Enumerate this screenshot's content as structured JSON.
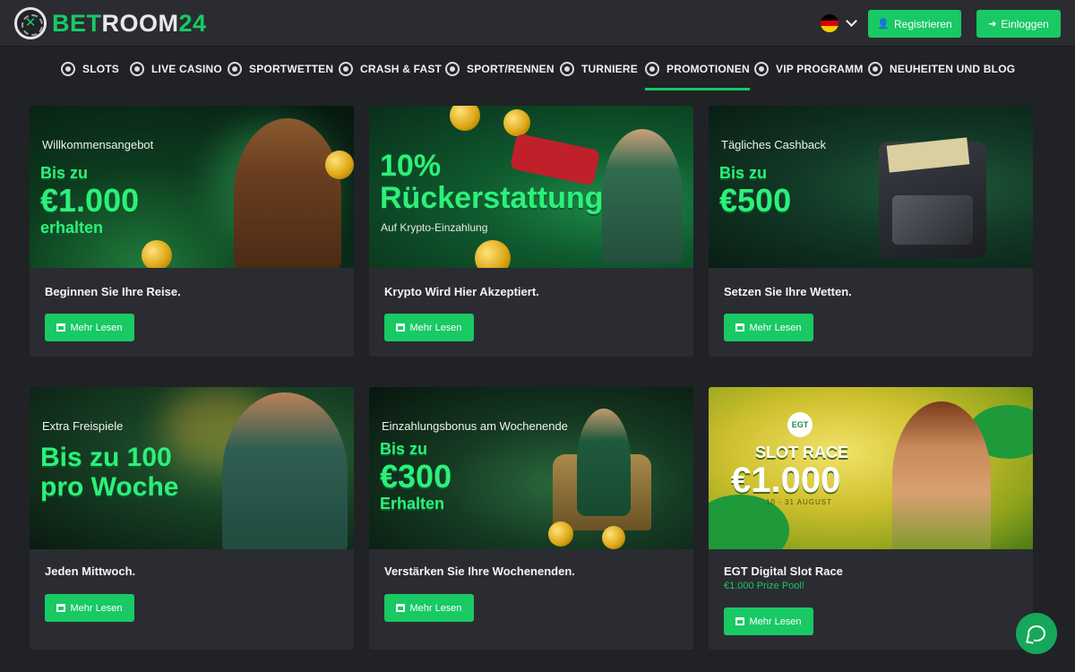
{
  "header": {
    "logo_bet": "BET",
    "logo_room": "ROOM",
    "logo_num": "24",
    "language_flag": "germany-flag",
    "register_label": "Registrieren",
    "login_label": "Einloggen"
  },
  "nav": {
    "items": [
      {
        "label": "SLOTS",
        "icon": "slots-icon"
      },
      {
        "label": "LIVE CASINO",
        "icon": "live-casino-icon"
      },
      {
        "label": "SPORTWETTEN",
        "icon": "sports-icon"
      },
      {
        "label": "CRASH & FAST",
        "icon": "rocket-icon"
      },
      {
        "label": "SPORT/RENNEN",
        "icon": "racing-icon"
      },
      {
        "label": "TURNIERE",
        "icon": "tournament-icon"
      },
      {
        "label": "PROMOTIONEN",
        "icon": "gift-icon"
      },
      {
        "label": "VIP PROGRAMM",
        "icon": "crown-icon"
      },
      {
        "label": "NEUHEITEN UND BLOG",
        "icon": "megaphone-icon"
      }
    ],
    "active": "PROMOTIONEN"
  },
  "promotions": [
    {
      "pretitle": "Willkommensangebot",
      "headline_1": "Bis zu",
      "headline_2": "€1.000",
      "headline_3": "erhalten",
      "title": "Beginnen Sie Ihre Reise.",
      "button": "Mehr Lesen"
    },
    {
      "headline_1": "10%",
      "headline_2": "Rückerstattung",
      "subline": "Auf Krypto-Einzahlung",
      "title": "Krypto Wird Hier Akzeptiert.",
      "button": "Mehr Lesen"
    },
    {
      "pretitle": "Tägliches Cashback",
      "headline_1": "Bis zu",
      "headline_2": "€500",
      "title": "Setzen Sie Ihre Wetten.",
      "button": "Mehr Lesen"
    },
    {
      "pretitle": "Extra Freispiele",
      "headline_1": "Bis zu 100",
      "headline_2": "pro Woche",
      "title": "Jeden Mittwoch.",
      "button": "Mehr Lesen"
    },
    {
      "pretitle": "Einzahlungsbonus am Wochenende",
      "headline_1": "Bis zu",
      "headline_2": "€300",
      "headline_3": "Erhalten",
      "title": "Verstärken Sie Ihre Wochenenden.",
      "button": "Mehr Lesen"
    },
    {
      "badge": "EGT",
      "headline_1": "SLOT RACE",
      "headline_2": "€1.000",
      "dates": "10 - 31 AUGUST",
      "title": "EGT Digital Slot Race",
      "subtitle": "€1.000 Prize Pool!",
      "button": "Mehr Lesen"
    }
  ],
  "colors": {
    "accent": "#18c964",
    "background": "#202226",
    "card": "#2a2c31"
  }
}
